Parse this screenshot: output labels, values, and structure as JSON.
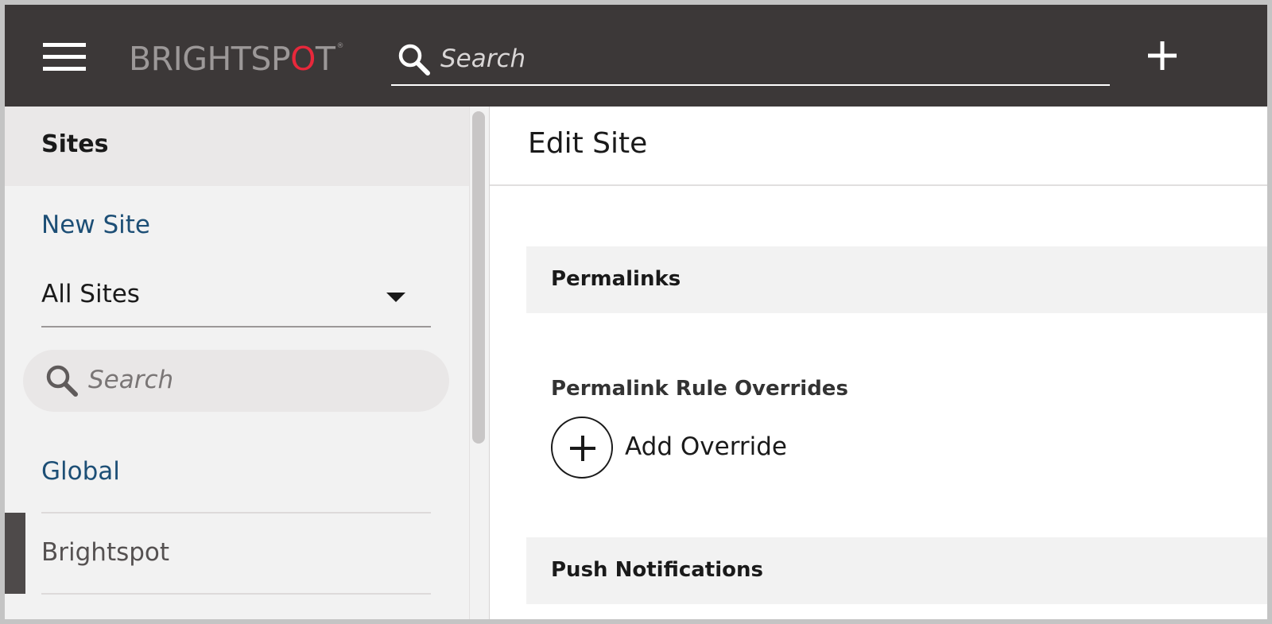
{
  "header": {
    "logo": {
      "pre": "BRIGHTSP",
      "accent": "O",
      "post": "T",
      "mark": "®"
    },
    "search_placeholder": "Search",
    "menu_icon": "hamburger-menu-icon",
    "create_icon": "plus-icon"
  },
  "sidebar": {
    "title": "Sites",
    "new_site": "New Site",
    "site_filter": {
      "selected": "All Sites"
    },
    "search_placeholder": "Search",
    "sites": [
      {
        "label": "Global"
      },
      {
        "label": "Brightspot",
        "active": true
      }
    ]
  },
  "main": {
    "title": "Edit Site",
    "sections": [
      {
        "label": "Permalinks"
      },
      {
        "label": "Push Notifications"
      }
    ],
    "permalink_field": {
      "label": "Permalink Rule Overrides",
      "add_label": "Add Override"
    }
  },
  "colors": {
    "header_bg": "#3c3838",
    "logo_accent": "#e8283b",
    "link": "#1d4f76",
    "sidebar_bg": "#f2f2f2"
  }
}
